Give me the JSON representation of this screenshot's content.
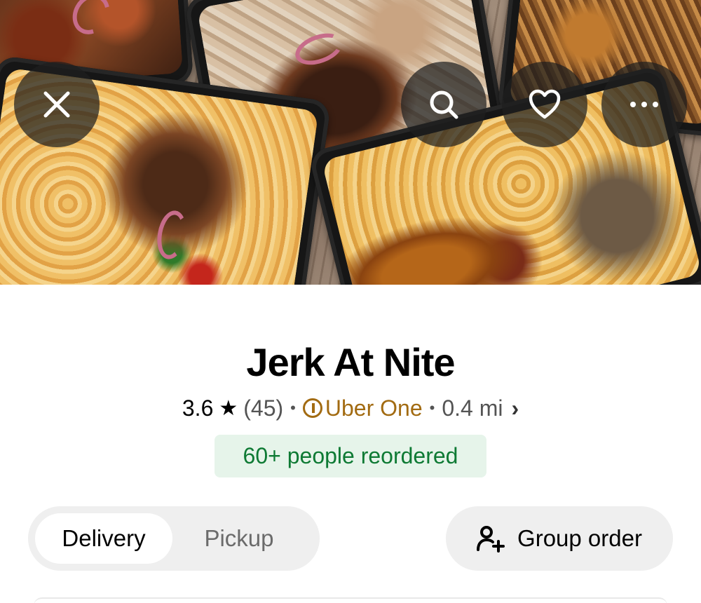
{
  "store": {
    "name": "Jerk At Nite",
    "rating": "3.6",
    "review_count": "(45)",
    "membership": "Uber One",
    "distance": "0.4 mi",
    "reorder_badge": "60+ people reordered"
  },
  "icons": {
    "close": "close-icon",
    "search": "search-icon",
    "favorite": "heart-icon",
    "more": "more-icon",
    "star": "star-icon",
    "uber_one": "uber-one-icon",
    "chevron": "chevron-right-icon",
    "group": "add-person-icon"
  },
  "fulfillment": {
    "options": [
      "Delivery",
      "Pickup"
    ],
    "selected": "Delivery"
  },
  "actions": {
    "group_order": "Group order"
  },
  "colors": {
    "accent_green": "#0e7a34",
    "badge_bg": "#e6f4ea",
    "uber_one_gold": "#a26b12",
    "chip_bg": "#efefef"
  }
}
